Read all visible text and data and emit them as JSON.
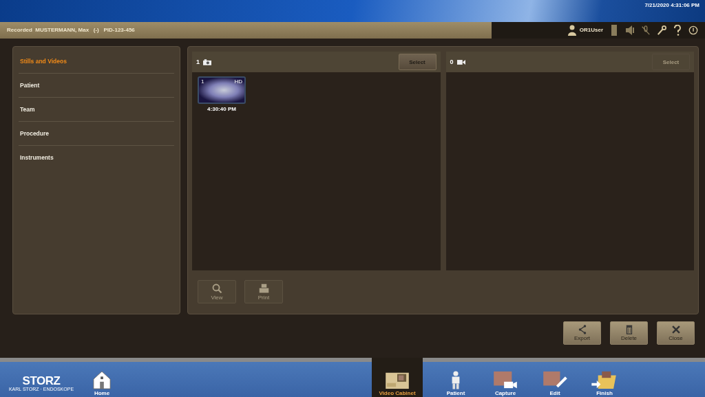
{
  "system_bar": {
    "datetime": "7/21/2020  4:31:06 PM"
  },
  "header": {
    "status": "Recorded  MUSTERMANN, Max   (-)   PID-123-456",
    "user": "OR1User"
  },
  "sidebar": {
    "items": [
      {
        "label": "Stills and Videos",
        "selected": true
      },
      {
        "label": "Patient",
        "selected": false
      },
      {
        "label": "Team",
        "selected": false
      },
      {
        "label": "Procedure",
        "selected": false
      },
      {
        "label": "Instruments",
        "selected": false
      }
    ]
  },
  "panes": [
    {
      "kind": "stills",
      "count": "1",
      "select": {
        "label": "Select",
        "disabled": false
      },
      "items": [
        {
          "number": "1",
          "quality": "HD",
          "time": "4:30:40 PM"
        }
      ]
    },
    {
      "kind": "videos",
      "count": "0",
      "select": {
        "label": "Select",
        "disabled": true
      }
    }
  ],
  "pane_tools": [
    {
      "kind": "view",
      "label": "View",
      "disabled": true
    },
    {
      "kind": "print",
      "label": "Print",
      "disabled": true
    }
  ],
  "actions": [
    {
      "kind": "export",
      "label": "Export"
    },
    {
      "kind": "delete",
      "label": "Delete"
    },
    {
      "kind": "close",
      "label": "Close"
    }
  ],
  "logo": {
    "name": "STORZ",
    "tagline": "KARL STORZ · ENDOSKOPE"
  },
  "nav": [
    {
      "kind": "home",
      "label": "Home",
      "selected": false
    },
    {
      "kind": "cabinet",
      "label": "Video Cabinet",
      "selected": true
    },
    {
      "kind": "patient",
      "label": "Patient",
      "selected": false
    },
    {
      "kind": "capture",
      "label": "Capture",
      "selected": false
    },
    {
      "kind": "edit",
      "label": "Edit",
      "selected": false
    },
    {
      "kind": "finish",
      "label": "Finish",
      "selected": false
    }
  ]
}
